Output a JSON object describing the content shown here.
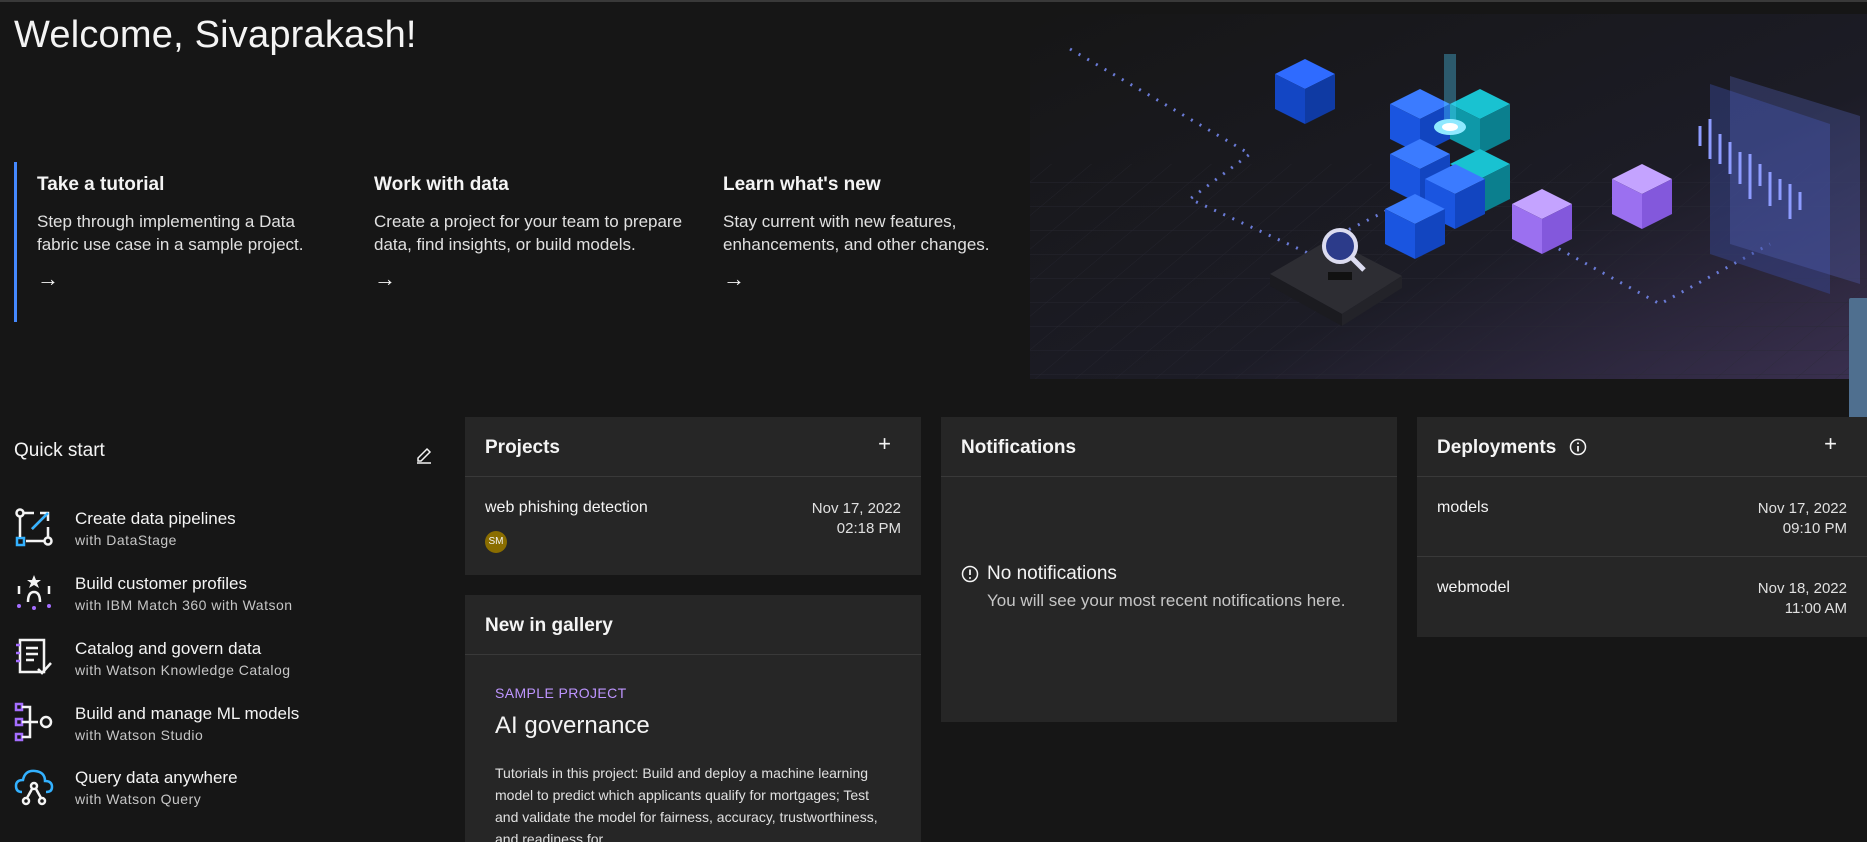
{
  "welcome": "Welcome, Sivaprakash!",
  "hero_cards": [
    {
      "title": "Take a tutorial",
      "desc": "Step through implementing a Data fabric use case in a sample project.",
      "arrow": "→"
    },
    {
      "title": "Work with data",
      "desc": "Create a project for your team to prepare data, find insights, or build models.",
      "arrow": "→"
    },
    {
      "title": "Learn what's new",
      "desc": "Stay current with new features, enhancements, and other changes.",
      "arrow": "→"
    }
  ],
  "quick_start": {
    "title": "Quick start",
    "items": [
      {
        "title": "Create data pipelines",
        "sub": "with DataStage",
        "icon": "pipeline-icon"
      },
      {
        "title": "Build customer profiles",
        "sub": "with IBM Match 360 with Watson",
        "icon": "customer-profile-icon"
      },
      {
        "title": "Catalog and govern data",
        "sub": "with Watson Knowledge Catalog",
        "icon": "catalog-icon"
      },
      {
        "title": "Build and manage ML models",
        "sub": "with Watson Studio",
        "icon": "ml-model-icon"
      },
      {
        "title": "Query data anywhere",
        "sub": "with Watson Query",
        "icon": "query-cloud-icon"
      }
    ]
  },
  "projects": {
    "title": "Projects",
    "add": "+",
    "rows": [
      {
        "name": "web phishing detection",
        "date": "Nov 17, 2022",
        "time": "02:18 PM",
        "avatar": "SM"
      }
    ]
  },
  "gallery": {
    "title": "New in gallery",
    "tag": "SAMPLE PROJECT",
    "item_title": "AI governance",
    "desc": "Tutorials in this project: Build and deploy a machine learning model to predict which applicants qualify for mortgages; Test and validate the model for fairness, accuracy, trustworthiness, and readiness for"
  },
  "notifications": {
    "title": "Notifications",
    "empty_title": "No notifications",
    "empty_sub": "You will see your most recent notifications here."
  },
  "deployments": {
    "title": "Deployments",
    "add": "+",
    "rows": [
      {
        "name": "models",
        "date": "Nov 17, 2022",
        "time": "09:10 PM"
      },
      {
        "name": "webmodel",
        "date": "Nov 18, 2022",
        "time": "11:00 AM"
      }
    ]
  },
  "colors": {
    "accent": "#4589ff",
    "purple": "#be95ff",
    "bg": "#161616",
    "panel": "#262626"
  }
}
